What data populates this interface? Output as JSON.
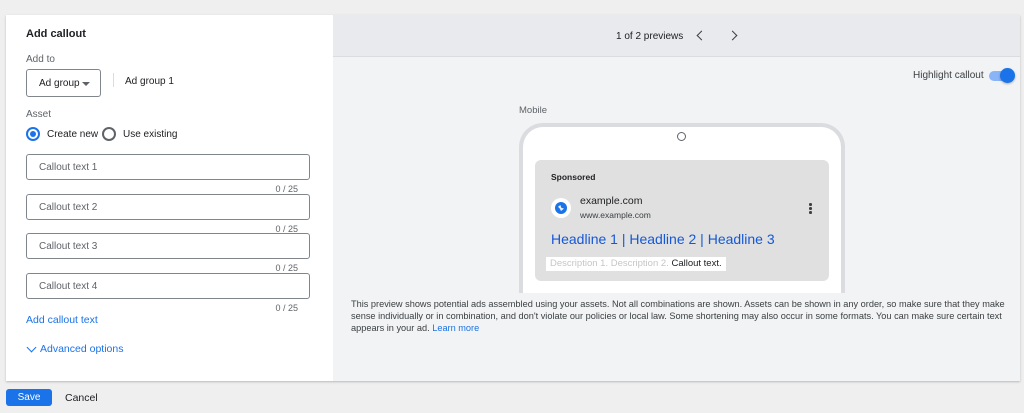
{
  "panel": {
    "title": "Add callout",
    "add_to_label": "Add to",
    "level_dropdown": "Ad group",
    "ad_group_name": "Ad group 1",
    "asset_label": "Asset",
    "radio_options": [
      {
        "label": "Create new",
        "selected": true
      },
      {
        "label": "Use existing",
        "selected": false
      }
    ],
    "fields": [
      {
        "placeholder": "Callout text 1",
        "counter": "0 / 25"
      },
      {
        "placeholder": "Callout text 2",
        "counter": "0 / 25"
      },
      {
        "placeholder": "Callout text 3",
        "counter": "0 / 25"
      },
      {
        "placeholder": "Callout text 4",
        "counter": "0 / 25"
      }
    ],
    "add_link": "Add callout text",
    "advanced_link": "Advanced options"
  },
  "preview": {
    "pager": "1 of 2 previews",
    "highlight_label": "Highlight callout",
    "highlight_on": true,
    "device_label": "Mobile",
    "ad": {
      "sponsored": "Sponsored",
      "domain": "example.com",
      "url": "www.example.com",
      "headline": "Headline 1 | Headline 2 | Headline 3",
      "description": "Description 1. Description 2.",
      "callout": "Callout text."
    },
    "note": "This preview shows potential ads assembled using your assets. Not all combinations are shown. Assets can be shown in any order, so make sure that they make sense individually or in combination, and don't violate our policies or local law. Some shortening may also occur in some formats. You can make sure certain text appears in your ad.",
    "learn_more": "Learn more"
  },
  "footer": {
    "save": "Save",
    "cancel": "Cancel"
  },
  "colors": {
    "accent": "#1a73e8",
    "headline": "#1558d6"
  }
}
